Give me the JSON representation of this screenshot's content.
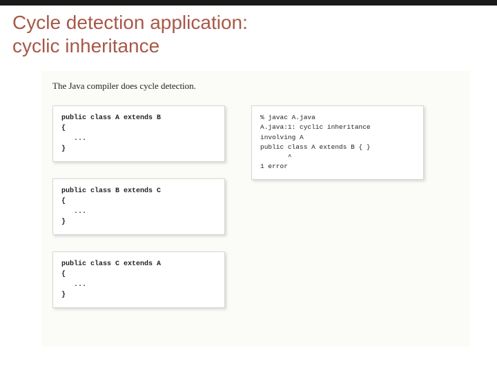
{
  "title": {
    "line1": "Cycle detection application:",
    "line2": "cyclic inheritance"
  },
  "lead": "The Java compiler does cycle detection.",
  "code": {
    "classA": "public class A extends B\n{\n   ...\n}",
    "classB": "public class B extends C\n{\n   ...\n}",
    "classC": "public class C extends A\n{\n   ...\n}"
  },
  "output": "% javac A.java\nA.java:1: cyclic inheritance\ninvolving A\npublic class A extends B { }\n       ^\n1 error"
}
